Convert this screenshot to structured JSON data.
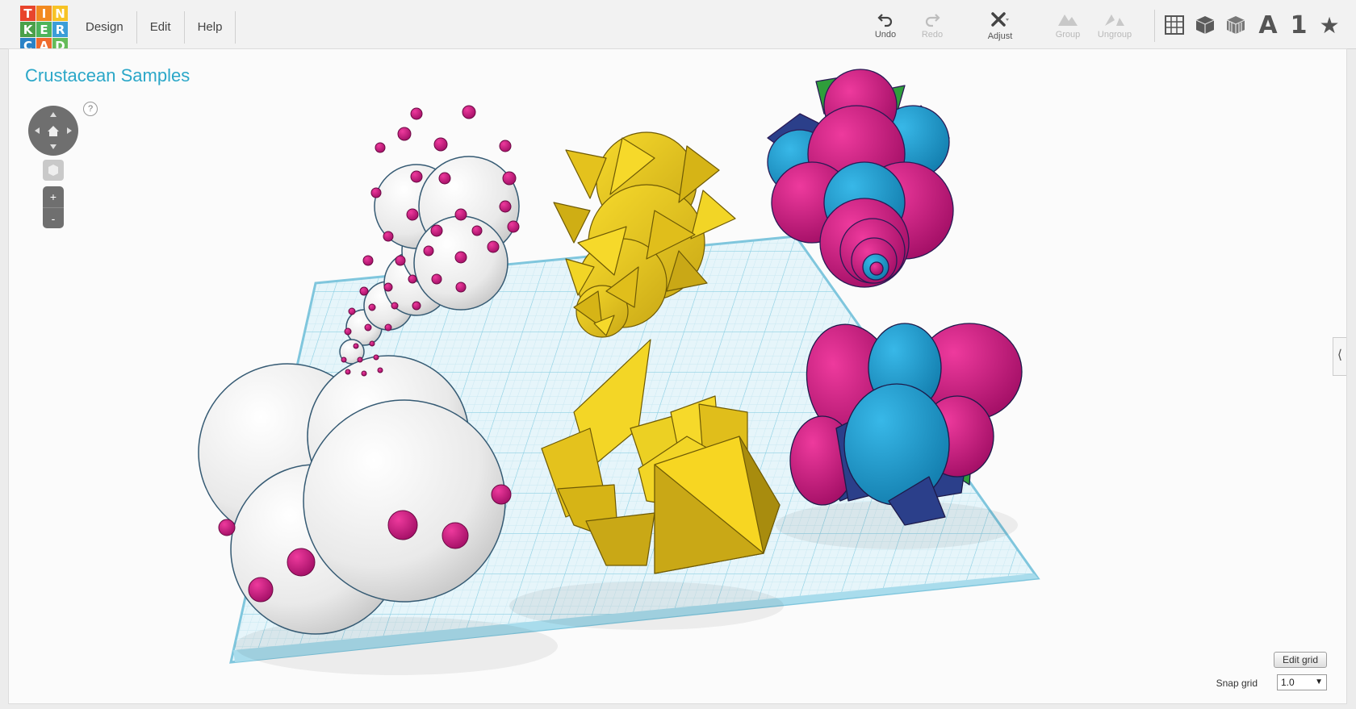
{
  "app": {
    "name": "Tinkercad"
  },
  "logo": {
    "letters": [
      "T",
      "I",
      "N",
      "K",
      "E",
      "R",
      "C",
      "A",
      "D"
    ],
    "colors": [
      "#e8452c",
      "#f28a20",
      "#f7c325",
      "#4ba04a",
      "#4cb45c",
      "#3b9dd8",
      "#2a82c6",
      "#ef6a2c",
      "#65bb5a"
    ]
  },
  "menu": {
    "items": [
      "Design",
      "Edit",
      "Help"
    ]
  },
  "toolbar": {
    "undo": "Undo",
    "redo": "Redo",
    "adjust": "Adjust",
    "group": "Group",
    "ungroup": "Ungroup",
    "text_icon": "A",
    "number_icon": "1",
    "favorite_icon": "★"
  },
  "workplane": {
    "title": "Crustacean Samples",
    "help": "?",
    "zoom_in": "+",
    "zoom_out": "-",
    "collapse": "⟨",
    "edit_grid": "Edit grid",
    "snap_label": "Snap grid",
    "snap_value": "1.0"
  },
  "colors": {
    "accent": "#2ba7c8",
    "grid": "#bfe4ef",
    "shell_white": "#f3f3f3",
    "spot_magenta": "#cc0077",
    "yellow": "#e7c61f",
    "magenta": "#d4137f",
    "cyan": "#1a9ed3",
    "navy": "#2b3f8a",
    "green": "#2f9e3b"
  }
}
